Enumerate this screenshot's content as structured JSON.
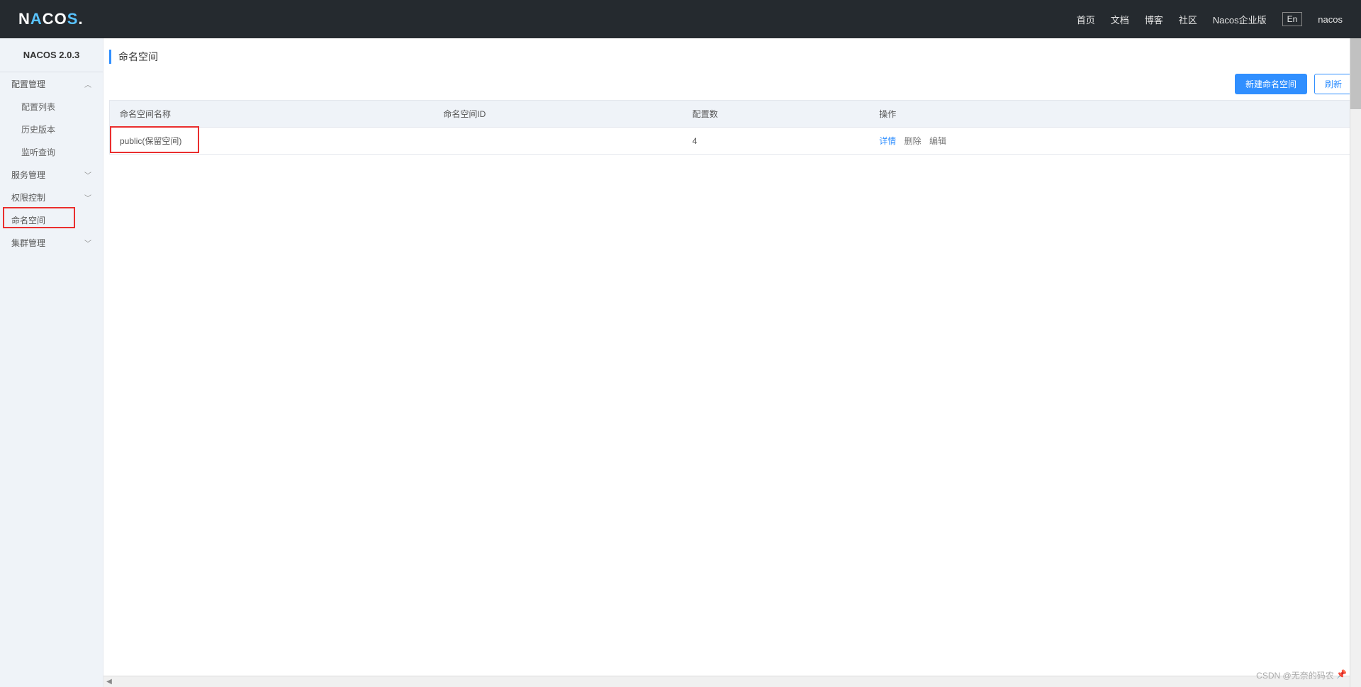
{
  "header": {
    "logo_text": "NACOS.",
    "nav": {
      "home": "首页",
      "docs": "文档",
      "blog": "博客",
      "community": "社区",
      "enterprise": "Nacos企业版"
    },
    "lang_toggle": "En",
    "user": "nacos"
  },
  "sidebar": {
    "version": "NACOS 2.0.3",
    "config_mgmt": "配置管理",
    "config_list": "配置列表",
    "history_version": "历史版本",
    "listen_query": "监听查询",
    "service_mgmt": "服务管理",
    "access_control": "权限控制",
    "namespace": "命名空间",
    "cluster_mgmt": "集群管理"
  },
  "page": {
    "title": "命名空间"
  },
  "toolbar": {
    "new_namespace": "新建命名空间",
    "refresh": "刷新"
  },
  "table": {
    "headers": {
      "name": "命名空间名称",
      "id": "命名空间ID",
      "config_count": "配置数",
      "actions": "操作"
    },
    "rows": [
      {
        "name": "public(保留空间)",
        "id": "",
        "config_count": "4",
        "actions": {
          "detail": "详情",
          "delete": "删除",
          "edit": "编辑"
        }
      }
    ]
  },
  "watermark": "CSDN @无奈的码农"
}
